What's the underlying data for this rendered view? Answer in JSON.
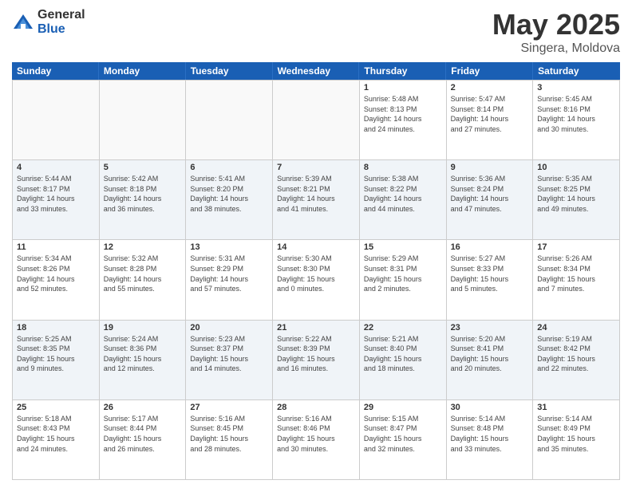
{
  "header": {
    "logo_general": "General",
    "logo_blue": "Blue",
    "title": "May 2025",
    "location": "Singera, Moldova"
  },
  "days_of_week": [
    "Sunday",
    "Monday",
    "Tuesday",
    "Wednesday",
    "Thursday",
    "Friday",
    "Saturday"
  ],
  "weeks": [
    [
      {
        "day": "",
        "text": ""
      },
      {
        "day": "",
        "text": ""
      },
      {
        "day": "",
        "text": ""
      },
      {
        "day": "",
        "text": ""
      },
      {
        "day": "1",
        "text": "Sunrise: 5:48 AM\nSunset: 8:13 PM\nDaylight: 14 hours\nand 24 minutes."
      },
      {
        "day": "2",
        "text": "Sunrise: 5:47 AM\nSunset: 8:14 PM\nDaylight: 14 hours\nand 27 minutes."
      },
      {
        "day": "3",
        "text": "Sunrise: 5:45 AM\nSunset: 8:16 PM\nDaylight: 14 hours\nand 30 minutes."
      }
    ],
    [
      {
        "day": "4",
        "text": "Sunrise: 5:44 AM\nSunset: 8:17 PM\nDaylight: 14 hours\nand 33 minutes."
      },
      {
        "day": "5",
        "text": "Sunrise: 5:42 AM\nSunset: 8:18 PM\nDaylight: 14 hours\nand 36 minutes."
      },
      {
        "day": "6",
        "text": "Sunrise: 5:41 AM\nSunset: 8:20 PM\nDaylight: 14 hours\nand 38 minutes."
      },
      {
        "day": "7",
        "text": "Sunrise: 5:39 AM\nSunset: 8:21 PM\nDaylight: 14 hours\nand 41 minutes."
      },
      {
        "day": "8",
        "text": "Sunrise: 5:38 AM\nSunset: 8:22 PM\nDaylight: 14 hours\nand 44 minutes."
      },
      {
        "day": "9",
        "text": "Sunrise: 5:36 AM\nSunset: 8:24 PM\nDaylight: 14 hours\nand 47 minutes."
      },
      {
        "day": "10",
        "text": "Sunrise: 5:35 AM\nSunset: 8:25 PM\nDaylight: 14 hours\nand 49 minutes."
      }
    ],
    [
      {
        "day": "11",
        "text": "Sunrise: 5:34 AM\nSunset: 8:26 PM\nDaylight: 14 hours\nand 52 minutes."
      },
      {
        "day": "12",
        "text": "Sunrise: 5:32 AM\nSunset: 8:28 PM\nDaylight: 14 hours\nand 55 minutes."
      },
      {
        "day": "13",
        "text": "Sunrise: 5:31 AM\nSunset: 8:29 PM\nDaylight: 14 hours\nand 57 minutes."
      },
      {
        "day": "14",
        "text": "Sunrise: 5:30 AM\nSunset: 8:30 PM\nDaylight: 15 hours\nand 0 minutes."
      },
      {
        "day": "15",
        "text": "Sunrise: 5:29 AM\nSunset: 8:31 PM\nDaylight: 15 hours\nand 2 minutes."
      },
      {
        "day": "16",
        "text": "Sunrise: 5:27 AM\nSunset: 8:33 PM\nDaylight: 15 hours\nand 5 minutes."
      },
      {
        "day": "17",
        "text": "Sunrise: 5:26 AM\nSunset: 8:34 PM\nDaylight: 15 hours\nand 7 minutes."
      }
    ],
    [
      {
        "day": "18",
        "text": "Sunrise: 5:25 AM\nSunset: 8:35 PM\nDaylight: 15 hours\nand 9 minutes."
      },
      {
        "day": "19",
        "text": "Sunrise: 5:24 AM\nSunset: 8:36 PM\nDaylight: 15 hours\nand 12 minutes."
      },
      {
        "day": "20",
        "text": "Sunrise: 5:23 AM\nSunset: 8:37 PM\nDaylight: 15 hours\nand 14 minutes."
      },
      {
        "day": "21",
        "text": "Sunrise: 5:22 AM\nSunset: 8:39 PM\nDaylight: 15 hours\nand 16 minutes."
      },
      {
        "day": "22",
        "text": "Sunrise: 5:21 AM\nSunset: 8:40 PM\nDaylight: 15 hours\nand 18 minutes."
      },
      {
        "day": "23",
        "text": "Sunrise: 5:20 AM\nSunset: 8:41 PM\nDaylight: 15 hours\nand 20 minutes."
      },
      {
        "day": "24",
        "text": "Sunrise: 5:19 AM\nSunset: 8:42 PM\nDaylight: 15 hours\nand 22 minutes."
      }
    ],
    [
      {
        "day": "25",
        "text": "Sunrise: 5:18 AM\nSunset: 8:43 PM\nDaylight: 15 hours\nand 24 minutes."
      },
      {
        "day": "26",
        "text": "Sunrise: 5:17 AM\nSunset: 8:44 PM\nDaylight: 15 hours\nand 26 minutes."
      },
      {
        "day": "27",
        "text": "Sunrise: 5:16 AM\nSunset: 8:45 PM\nDaylight: 15 hours\nand 28 minutes."
      },
      {
        "day": "28",
        "text": "Sunrise: 5:16 AM\nSunset: 8:46 PM\nDaylight: 15 hours\nand 30 minutes."
      },
      {
        "day": "29",
        "text": "Sunrise: 5:15 AM\nSunset: 8:47 PM\nDaylight: 15 hours\nand 32 minutes."
      },
      {
        "day": "30",
        "text": "Sunrise: 5:14 AM\nSunset: 8:48 PM\nDaylight: 15 hours\nand 33 minutes."
      },
      {
        "day": "31",
        "text": "Sunrise: 5:14 AM\nSunset: 8:49 PM\nDaylight: 15 hours\nand 35 minutes."
      }
    ]
  ]
}
